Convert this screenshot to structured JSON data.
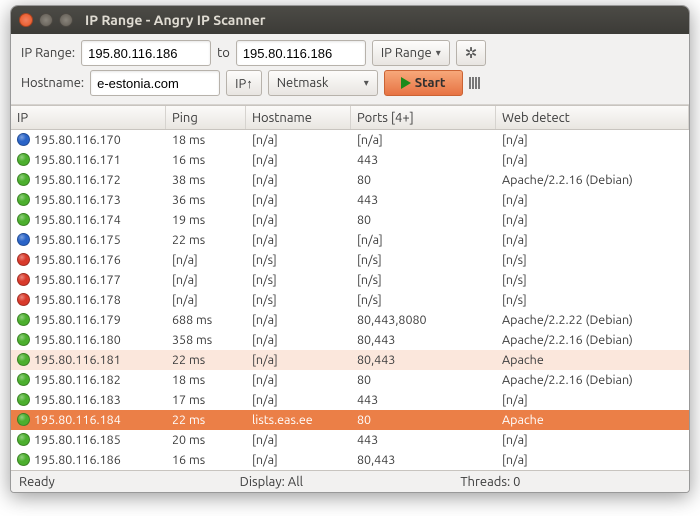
{
  "window": {
    "title": "IP Range - Angry IP Scanner"
  },
  "toolbar": {
    "ip_range_label": "IP Range:",
    "ip_from": "195.80.116.186",
    "to_label": "to",
    "ip_to": "195.80.116.186",
    "range_type": "IP Range",
    "hostname_label": "Hostname:",
    "hostname": "e-estonia.com",
    "ip_up": "IP↑",
    "netmask": "Netmask",
    "start_label": "Start"
  },
  "columns": {
    "ip": "IP",
    "ping": "Ping",
    "hostname": "Hostname",
    "ports": "Ports [4+]",
    "web": "Web detect"
  },
  "rows": [
    {
      "status": "blue",
      "ip": "195.80.116.170",
      "ping": "18 ms",
      "host": "[n/a]",
      "ports": "[n/a]",
      "web": "[n/a]"
    },
    {
      "status": "green",
      "ip": "195.80.116.171",
      "ping": "16 ms",
      "host": "[n/a]",
      "ports": "443",
      "web": "[n/a]"
    },
    {
      "status": "green",
      "ip": "195.80.116.172",
      "ping": "38 ms",
      "host": "[n/a]",
      "ports": "80",
      "web": "Apache/2.2.16 (Debian)"
    },
    {
      "status": "green",
      "ip": "195.80.116.173",
      "ping": "36 ms",
      "host": "[n/a]",
      "ports": "443",
      "web": "[n/a]"
    },
    {
      "status": "green",
      "ip": "195.80.116.174",
      "ping": "19 ms",
      "host": "[n/a]",
      "ports": "80",
      "web": "[n/a]"
    },
    {
      "status": "blue",
      "ip": "195.80.116.175",
      "ping": "22 ms",
      "host": "[n/a]",
      "ports": "[n/a]",
      "web": "[n/a]"
    },
    {
      "status": "red",
      "ip": "195.80.116.176",
      "ping": "[n/a]",
      "host": "[n/s]",
      "ports": "[n/s]",
      "web": "[n/s]"
    },
    {
      "status": "red",
      "ip": "195.80.116.177",
      "ping": "[n/a]",
      "host": "[n/s]",
      "ports": "[n/s]",
      "web": "[n/s]"
    },
    {
      "status": "red",
      "ip": "195.80.116.178",
      "ping": "[n/a]",
      "host": "[n/s]",
      "ports": "[n/s]",
      "web": "[n/s]"
    },
    {
      "status": "green",
      "ip": "195.80.116.179",
      "ping": "688 ms",
      "host": "[n/a]",
      "ports": "80,443,8080",
      "web": "Apache/2.2.22 (Debian)"
    },
    {
      "status": "green",
      "ip": "195.80.116.180",
      "ping": "358 ms",
      "host": "[n/a]",
      "ports": "80,443",
      "web": "Apache/2.2.16 (Debian)"
    },
    {
      "status": "green",
      "ip": "195.80.116.181",
      "ping": "22 ms",
      "host": "[n/a]",
      "ports": "80,443",
      "web": "Apache",
      "hover": true
    },
    {
      "status": "green",
      "ip": "195.80.116.182",
      "ping": "18 ms",
      "host": "[n/a]",
      "ports": "80",
      "web": "Apache/2.2.16 (Debian)"
    },
    {
      "status": "green",
      "ip": "195.80.116.183",
      "ping": "17 ms",
      "host": "[n/a]",
      "ports": "443",
      "web": "[n/a]"
    },
    {
      "status": "green",
      "ip": "195.80.116.184",
      "ping": "22 ms",
      "host": "lists.eas.ee",
      "ports": "80",
      "web": "Apache",
      "selected": true
    },
    {
      "status": "green",
      "ip": "195.80.116.185",
      "ping": "20 ms",
      "host": "[n/a]",
      "ports": "443",
      "web": "[n/a]"
    },
    {
      "status": "green",
      "ip": "195.80.116.186",
      "ping": "16 ms",
      "host": "[n/a]",
      "ports": "80,443",
      "web": "[n/a]"
    }
  ],
  "status": {
    "ready": "Ready",
    "display": "Display: All",
    "threads": "Threads: 0"
  },
  "colors": {
    "accent": "#e77343",
    "green": "#4caf2e",
    "blue": "#2a64c8",
    "red": "#d93a2b"
  }
}
